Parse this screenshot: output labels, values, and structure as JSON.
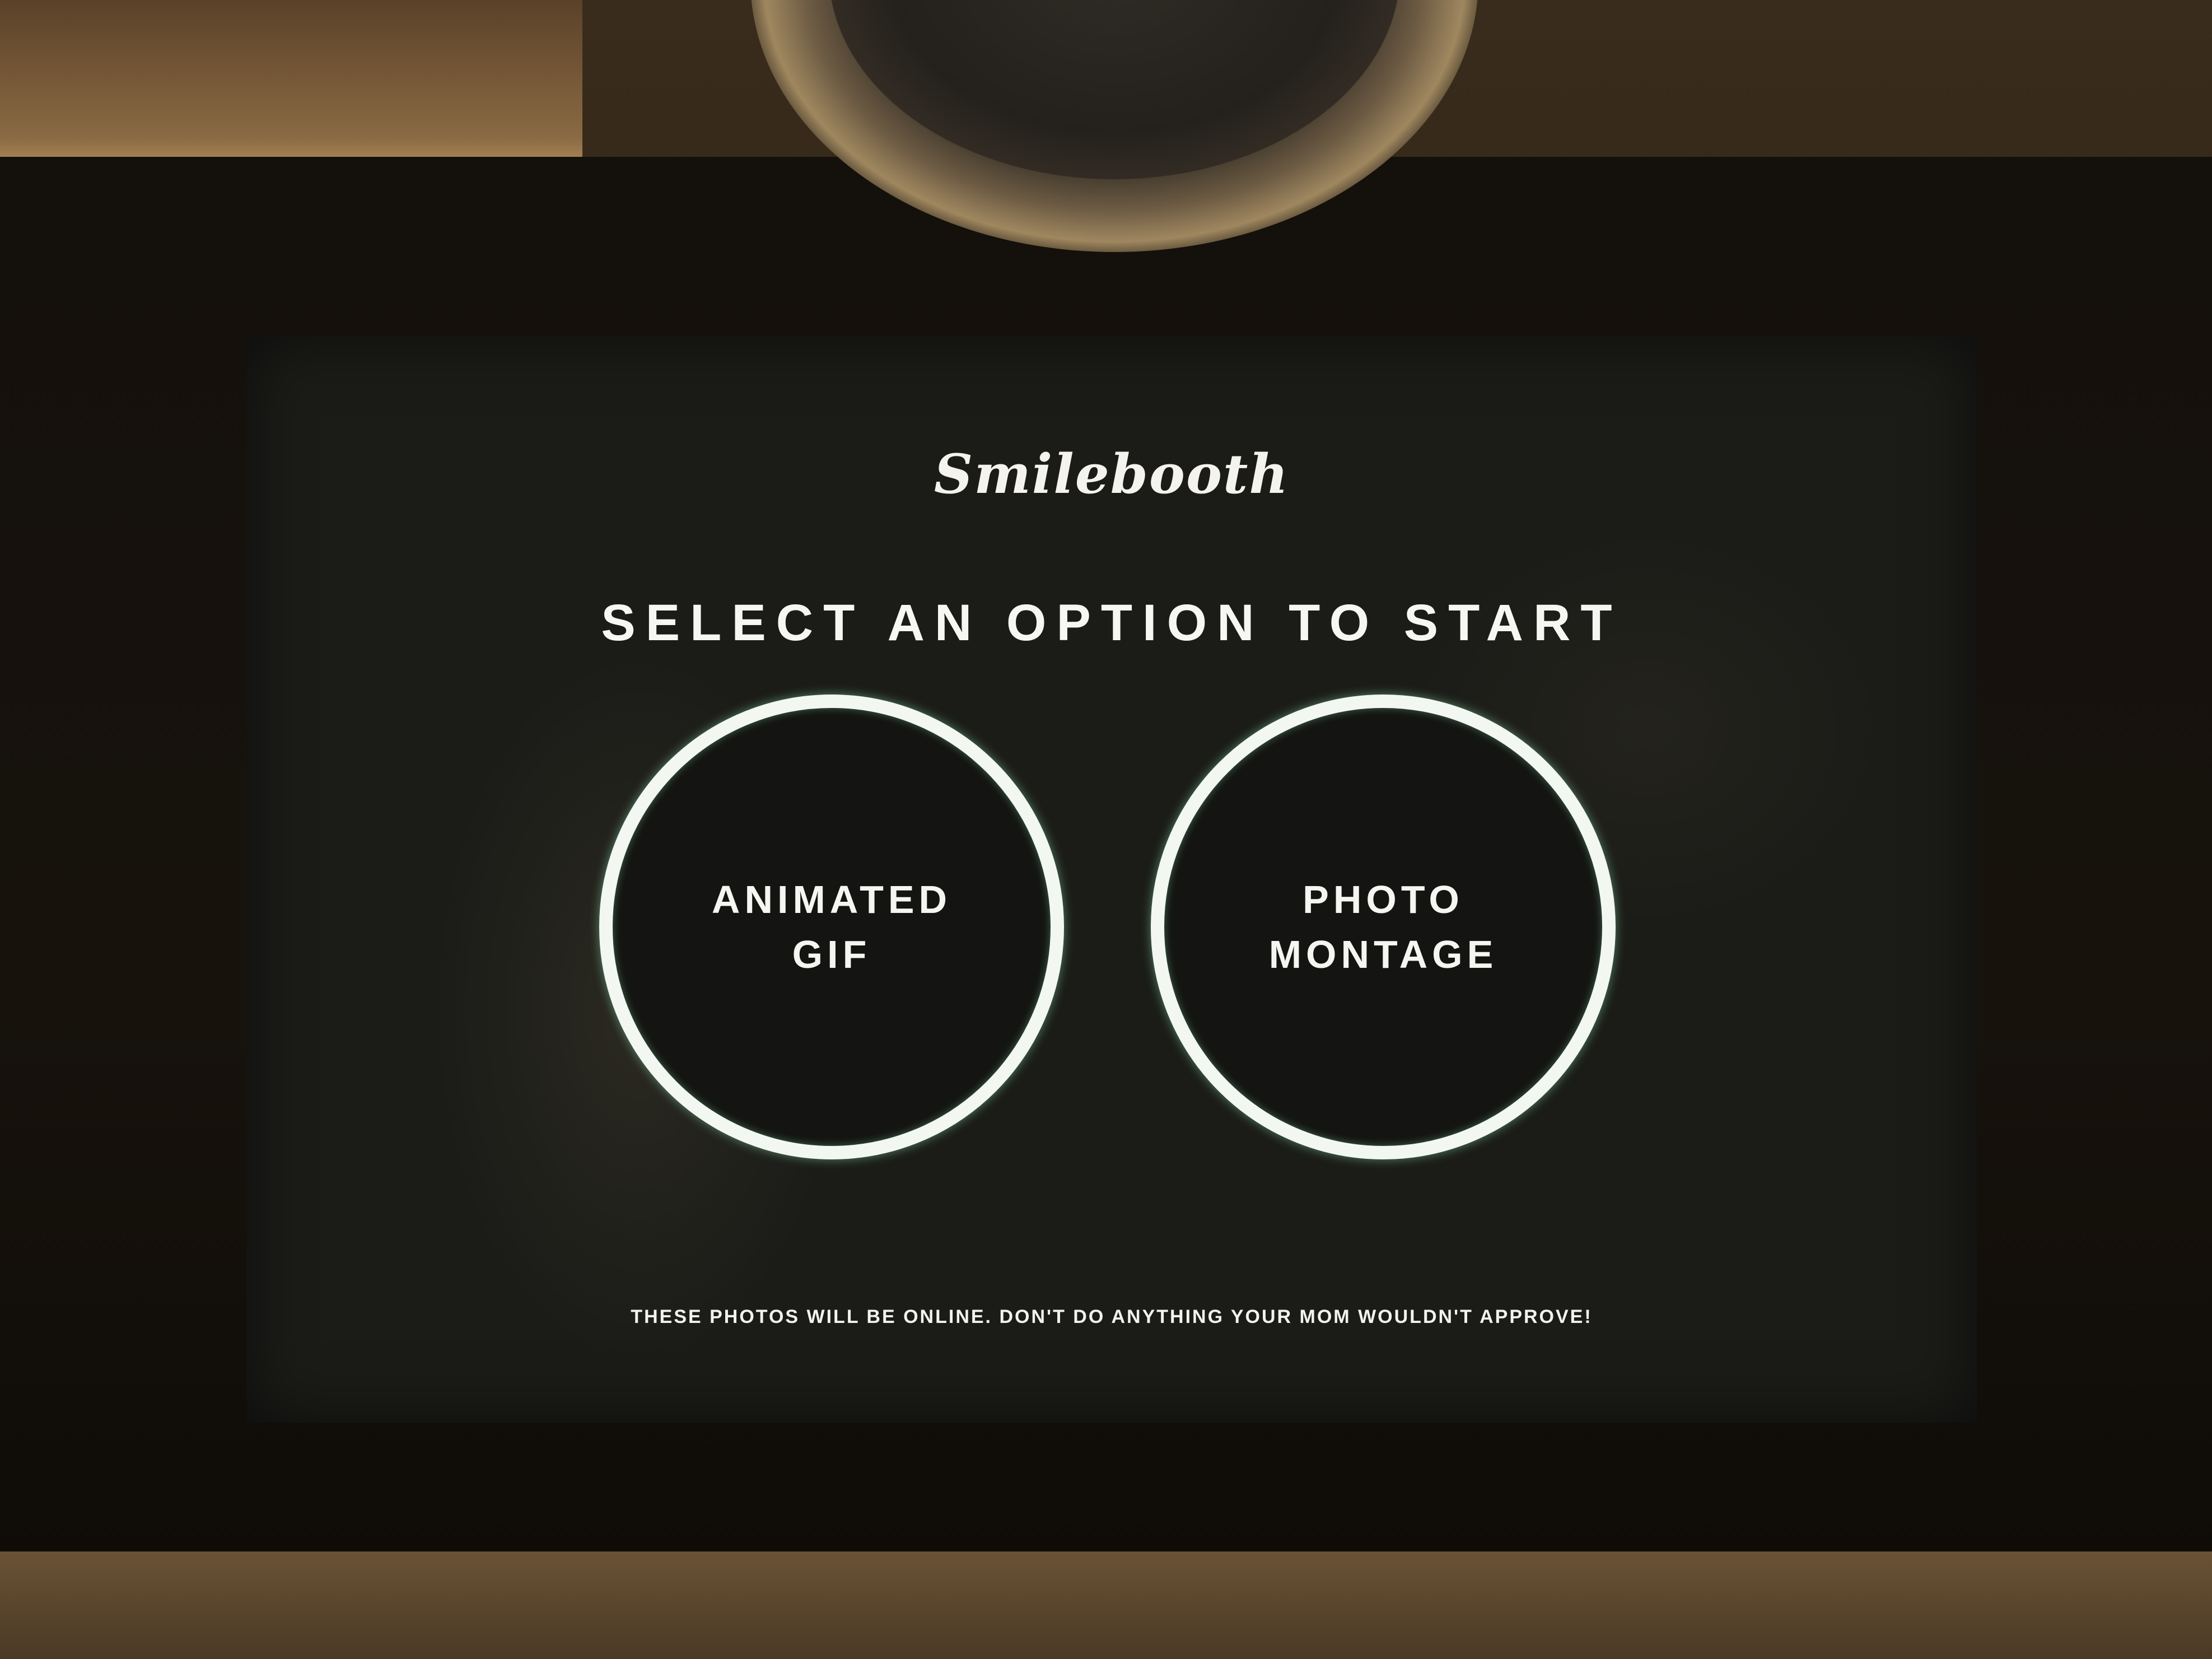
{
  "screen": {
    "logo_text": "Smilebooth",
    "headline": "SELECT AN OPTION TO START",
    "options": [
      {
        "label": "ANIMATED\nGIF"
      },
      {
        "label": "PHOTO\nMONTAGE"
      }
    ],
    "disclaimer": "THESE PHOTOS WILL BE ONLINE. DON'T DO ANYTHING YOUR MOM WOULDN'T APPROVE!"
  },
  "colors": {
    "screen_background": "#1b1c18",
    "text": "#f6f6f2",
    "option_ring": "#f2f7f2",
    "option_glow": "#a0ffc8"
  }
}
